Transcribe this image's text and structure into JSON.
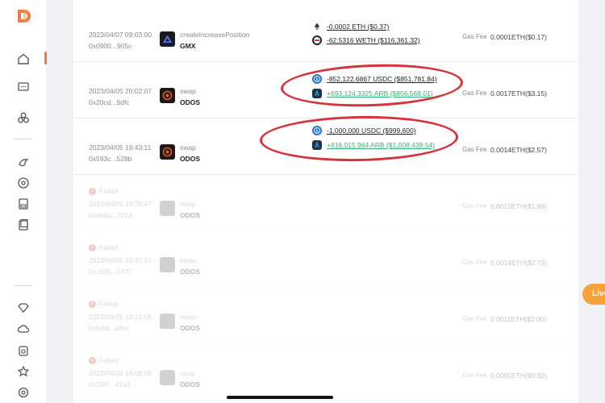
{
  "colors": {
    "accent": "#f07a4a",
    "positive": "#3bb273",
    "highlight": "#d6333b",
    "live": "#f5a23a"
  },
  "sidebar": {
    "icons": [
      "home-icon",
      "chat-icon",
      "circles-icon",
      "bird-icon",
      "disc-icon",
      "save-icon",
      "book-icon",
      "diamond-icon",
      "cloud-icon",
      "lock-icon",
      "star-icon",
      "settings-icon"
    ]
  },
  "transactions": [
    {
      "date": "2023/04/07 09:03:00",
      "hash": "0x0900...905c",
      "action": "createIncreasePosition",
      "protocol": "GMX",
      "tokens": [
        {
          "text": "-0.0002 ETH ($0.37)",
          "dir": "out"
        },
        {
          "text": "-62.5316 WETH ($116,361.32)",
          "dir": "out"
        }
      ],
      "gas_label": "Gas Fee",
      "gas": "0.0001ETH($0.17)"
    },
    {
      "date": "2023/04/05 20:02:07",
      "hash": "0x20cd...9dfc",
      "action": "swap",
      "protocol": "ODOS",
      "tokens": [
        {
          "text": "-852,122.6867 USDC ($851,781.84)",
          "dir": "out"
        },
        {
          "text": "+693,124.3325 ARB ($856,569.01)",
          "dir": "in"
        }
      ],
      "gas_label": "Gas Fee",
      "gas": "0.0017ETH($3.15)"
    },
    {
      "date": "2023/04/05 19:43:11",
      "hash": "0x593c...528b",
      "action": "swap",
      "protocol": "ODOS",
      "tokens": [
        {
          "text": "-1,000,000 USDC ($999,600)",
          "dir": "out"
        },
        {
          "text": "+816,015.964 ARB ($1,008,439.54)",
          "dir": "in"
        }
      ],
      "gas_label": "Gas Fee",
      "gas": "0.0014ETH($2.57)"
    },
    {
      "failed_label": "Failed",
      "date": "2023/04/05 19:38:47",
      "hash": "0xa9da...7219",
      "action": "swap",
      "protocol": "ODOS",
      "gas_label": "Gas Fee",
      "gas": "0.0010ETH($1.98)"
    },
    {
      "failed_label": "Failed",
      "date": "2023/04/05 19:37:37",
      "hash": "0xc925...7477",
      "action": "swap",
      "protocol": "ODOS",
      "gas_label": "Gas Fee",
      "gas": "0.0014ETH($2.73)"
    },
    {
      "failed_label": "Failed",
      "date": "2023/04/05 19:14:06",
      "hash": "0xfab8...a8ec",
      "action": "swap",
      "protocol": "ODOS",
      "gas_label": "Gas Fee",
      "gas": "0.0011ETH($2.00)"
    },
    {
      "failed_label": "Failed",
      "date": "2023/04/05 19:09:56",
      "hash": "0x2f97...41a3",
      "action": "swap",
      "protocol": "ODOS",
      "gas_label": "Gas Fee",
      "gas": "0.0005ETH($0.92)"
    }
  ],
  "live_tab": "Live"
}
